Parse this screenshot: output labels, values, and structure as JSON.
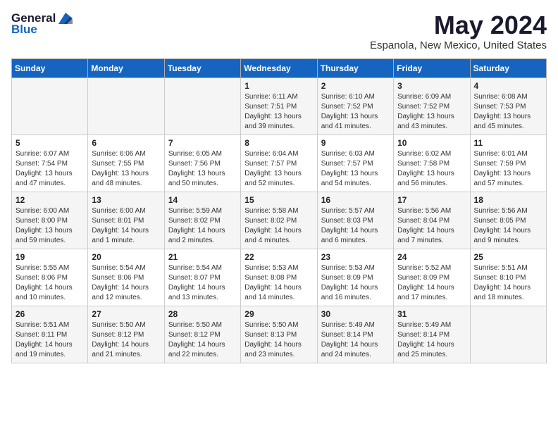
{
  "logo": {
    "general": "General",
    "blue": "Blue"
  },
  "title": "May 2024",
  "location": "Espanola, New Mexico, United States",
  "days_of_week": [
    "Sunday",
    "Monday",
    "Tuesday",
    "Wednesday",
    "Thursday",
    "Friday",
    "Saturday"
  ],
  "weeks": [
    [
      {
        "day": "",
        "content": ""
      },
      {
        "day": "",
        "content": ""
      },
      {
        "day": "",
        "content": ""
      },
      {
        "day": "1",
        "content": "Sunrise: 6:11 AM\nSunset: 7:51 PM\nDaylight: 13 hours\nand 39 minutes."
      },
      {
        "day": "2",
        "content": "Sunrise: 6:10 AM\nSunset: 7:52 PM\nDaylight: 13 hours\nand 41 minutes."
      },
      {
        "day": "3",
        "content": "Sunrise: 6:09 AM\nSunset: 7:52 PM\nDaylight: 13 hours\nand 43 minutes."
      },
      {
        "day": "4",
        "content": "Sunrise: 6:08 AM\nSunset: 7:53 PM\nDaylight: 13 hours\nand 45 minutes."
      }
    ],
    [
      {
        "day": "5",
        "content": "Sunrise: 6:07 AM\nSunset: 7:54 PM\nDaylight: 13 hours\nand 47 minutes."
      },
      {
        "day": "6",
        "content": "Sunrise: 6:06 AM\nSunset: 7:55 PM\nDaylight: 13 hours\nand 48 minutes."
      },
      {
        "day": "7",
        "content": "Sunrise: 6:05 AM\nSunset: 7:56 PM\nDaylight: 13 hours\nand 50 minutes."
      },
      {
        "day": "8",
        "content": "Sunrise: 6:04 AM\nSunset: 7:57 PM\nDaylight: 13 hours\nand 52 minutes."
      },
      {
        "day": "9",
        "content": "Sunrise: 6:03 AM\nSunset: 7:57 PM\nDaylight: 13 hours\nand 54 minutes."
      },
      {
        "day": "10",
        "content": "Sunrise: 6:02 AM\nSunset: 7:58 PM\nDaylight: 13 hours\nand 56 minutes."
      },
      {
        "day": "11",
        "content": "Sunrise: 6:01 AM\nSunset: 7:59 PM\nDaylight: 13 hours\nand 57 minutes."
      }
    ],
    [
      {
        "day": "12",
        "content": "Sunrise: 6:00 AM\nSunset: 8:00 PM\nDaylight: 13 hours\nand 59 minutes."
      },
      {
        "day": "13",
        "content": "Sunrise: 6:00 AM\nSunset: 8:01 PM\nDaylight: 14 hours\nand 1 minute."
      },
      {
        "day": "14",
        "content": "Sunrise: 5:59 AM\nSunset: 8:02 PM\nDaylight: 14 hours\nand 2 minutes."
      },
      {
        "day": "15",
        "content": "Sunrise: 5:58 AM\nSunset: 8:02 PM\nDaylight: 14 hours\nand 4 minutes."
      },
      {
        "day": "16",
        "content": "Sunrise: 5:57 AM\nSunset: 8:03 PM\nDaylight: 14 hours\nand 6 minutes."
      },
      {
        "day": "17",
        "content": "Sunrise: 5:56 AM\nSunset: 8:04 PM\nDaylight: 14 hours\nand 7 minutes."
      },
      {
        "day": "18",
        "content": "Sunrise: 5:56 AM\nSunset: 8:05 PM\nDaylight: 14 hours\nand 9 minutes."
      }
    ],
    [
      {
        "day": "19",
        "content": "Sunrise: 5:55 AM\nSunset: 8:06 PM\nDaylight: 14 hours\nand 10 minutes."
      },
      {
        "day": "20",
        "content": "Sunrise: 5:54 AM\nSunset: 8:06 PM\nDaylight: 14 hours\nand 12 minutes."
      },
      {
        "day": "21",
        "content": "Sunrise: 5:54 AM\nSunset: 8:07 PM\nDaylight: 14 hours\nand 13 minutes."
      },
      {
        "day": "22",
        "content": "Sunrise: 5:53 AM\nSunset: 8:08 PM\nDaylight: 14 hours\nand 14 minutes."
      },
      {
        "day": "23",
        "content": "Sunrise: 5:53 AM\nSunset: 8:09 PM\nDaylight: 14 hours\nand 16 minutes."
      },
      {
        "day": "24",
        "content": "Sunrise: 5:52 AM\nSunset: 8:09 PM\nDaylight: 14 hours\nand 17 minutes."
      },
      {
        "day": "25",
        "content": "Sunrise: 5:51 AM\nSunset: 8:10 PM\nDaylight: 14 hours\nand 18 minutes."
      }
    ],
    [
      {
        "day": "26",
        "content": "Sunrise: 5:51 AM\nSunset: 8:11 PM\nDaylight: 14 hours\nand 19 minutes."
      },
      {
        "day": "27",
        "content": "Sunrise: 5:50 AM\nSunset: 8:12 PM\nDaylight: 14 hours\nand 21 minutes."
      },
      {
        "day": "28",
        "content": "Sunrise: 5:50 AM\nSunset: 8:12 PM\nDaylight: 14 hours\nand 22 minutes."
      },
      {
        "day": "29",
        "content": "Sunrise: 5:50 AM\nSunset: 8:13 PM\nDaylight: 14 hours\nand 23 minutes."
      },
      {
        "day": "30",
        "content": "Sunrise: 5:49 AM\nSunset: 8:14 PM\nDaylight: 14 hours\nand 24 minutes."
      },
      {
        "day": "31",
        "content": "Sunrise: 5:49 AM\nSunset: 8:14 PM\nDaylight: 14 hours\nand 25 minutes."
      },
      {
        "day": "",
        "content": ""
      }
    ]
  ]
}
